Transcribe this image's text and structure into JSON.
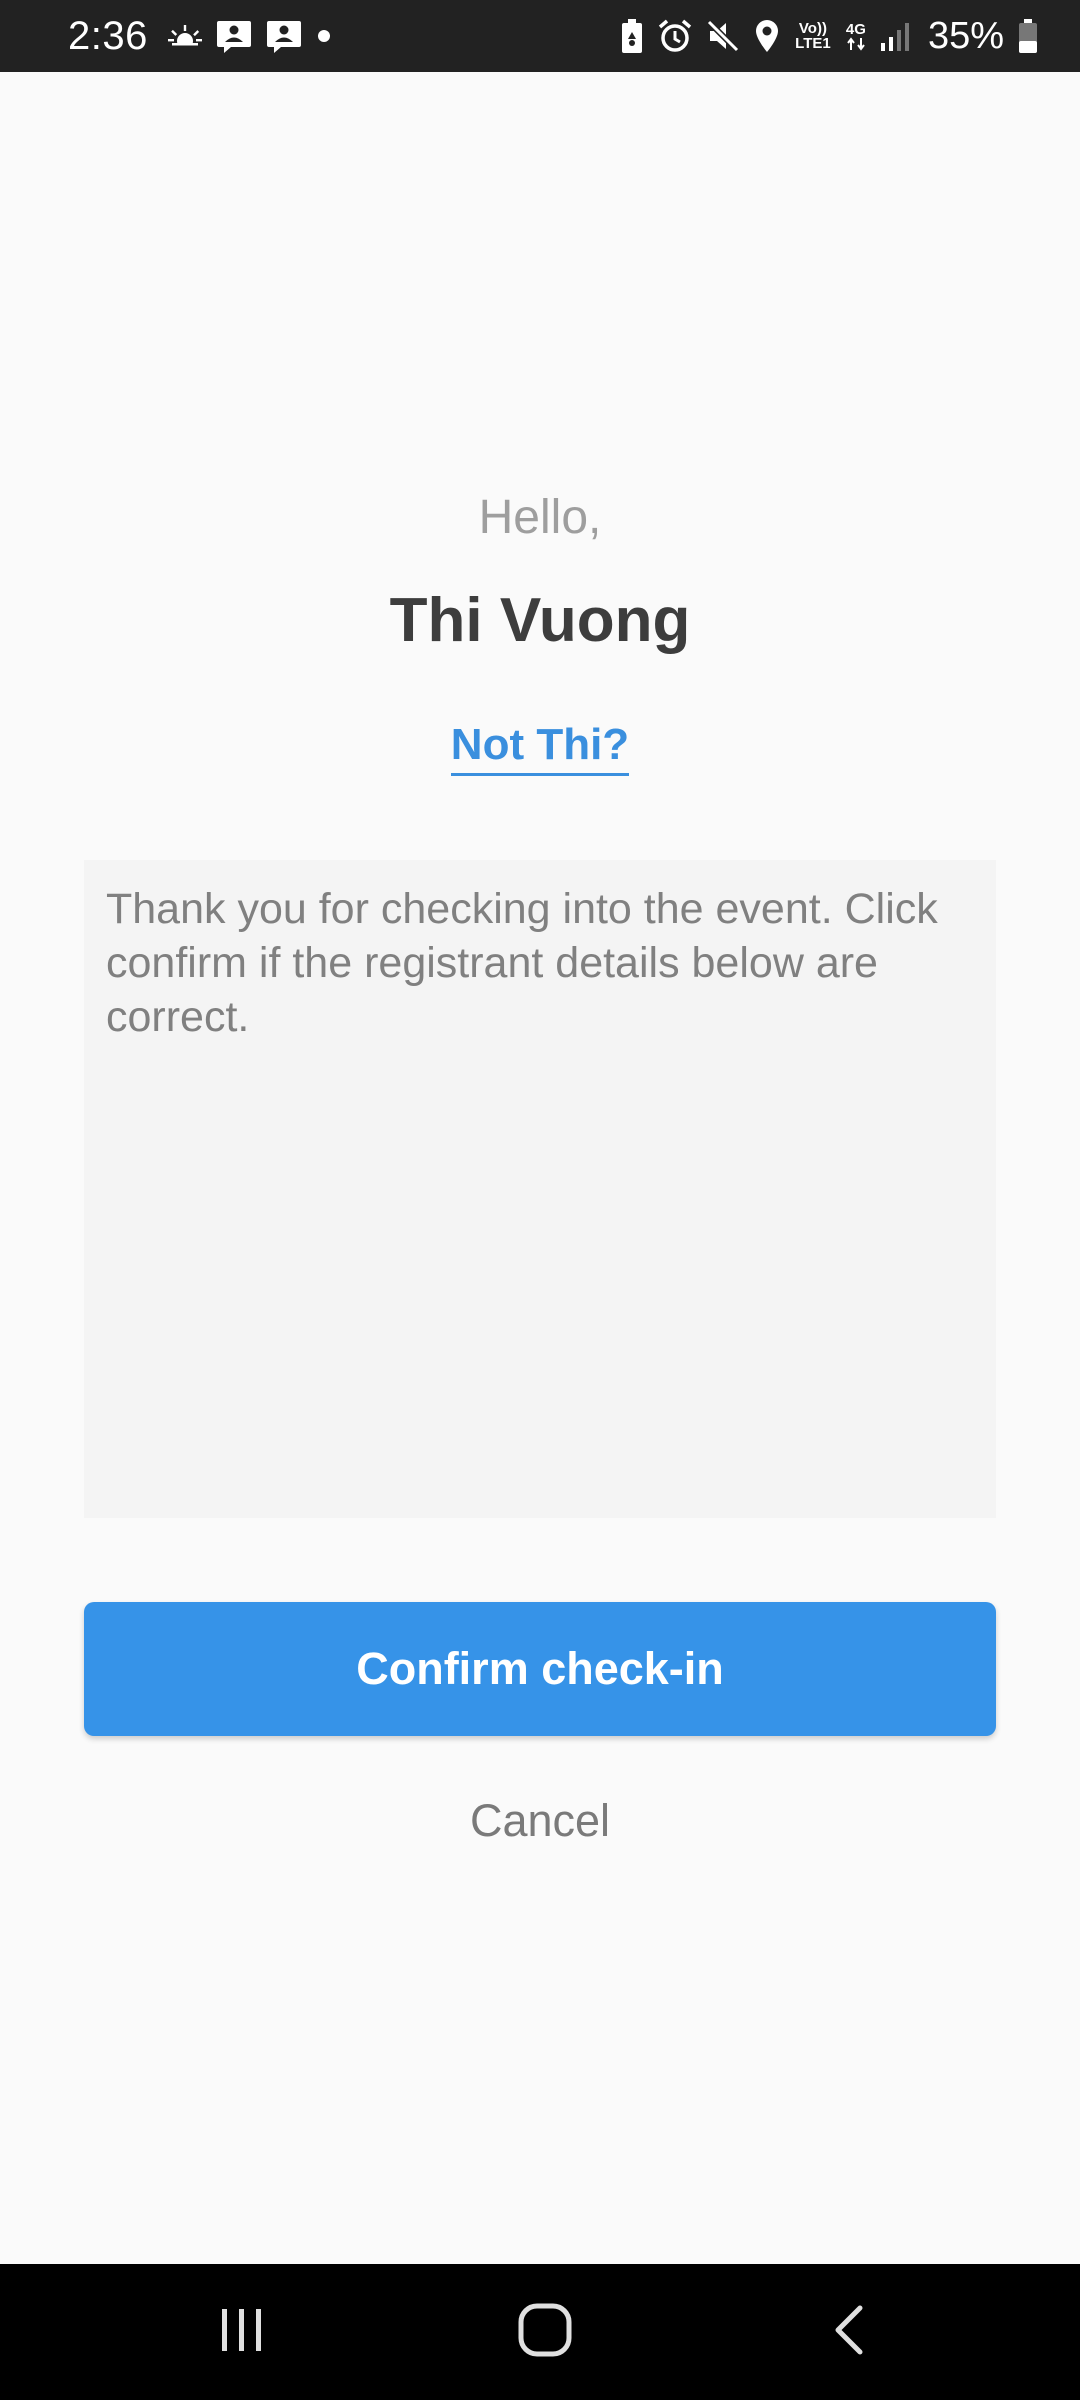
{
  "status_bar": {
    "time": "2:36",
    "network_volte": "Vo)) LTE1",
    "network_4g": "4G",
    "battery_percent": "35%",
    "icons_left": [
      "weather-icon",
      "contact-notification-icon",
      "contact-notification-icon",
      "dot-icon"
    ],
    "icons_right": [
      "battery-saver-icon",
      "alarm-icon",
      "mute-icon",
      "location-icon",
      "volte-icon",
      "4g-icon",
      "signal-icon",
      "battery-icon"
    ]
  },
  "greeting": {
    "hello": "Hello,",
    "name": "Thi Vuong",
    "not_link": "Not Thi?"
  },
  "message": {
    "text": "Thank you for checking into the event. Click confirm if the registrant details below are correct."
  },
  "actions": {
    "confirm_label": "Confirm check-in",
    "cancel_label": "Cancel"
  },
  "nav_bar": {
    "icons": [
      "recents-icon",
      "home-icon",
      "back-icon"
    ]
  },
  "colors": {
    "accent": "#3693e8",
    "link": "#3a8fde",
    "status_bar": "#222222",
    "background": "#fafafa"
  }
}
